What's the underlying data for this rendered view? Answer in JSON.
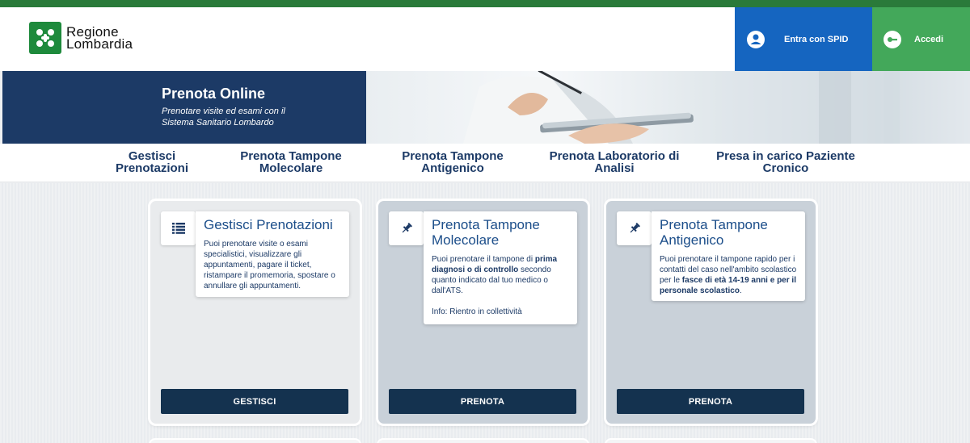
{
  "colors": {
    "brand_green": "#1e8a3c",
    "spid_blue": "#1565c0",
    "accedi_green": "#43a85a",
    "navy": "#1c3a66",
    "button_navy": "#14324f"
  },
  "header": {
    "logo_line1": "Regione",
    "logo_line2": "Lombardia",
    "spid_label": "Entra con SPID",
    "spid_icon": "user-icon",
    "accedi_label": "Accedi",
    "accedi_icon": "key-icon"
  },
  "hero": {
    "title": "Prenota Online",
    "subtitle_line1": "Prenotare visite ed esami con il",
    "subtitle_line2": "Sistema Sanitario Lombardo"
  },
  "nav": {
    "items": [
      {
        "line1": "Gestisci",
        "line2": "Prenotazioni"
      },
      {
        "line1": "Prenota Tampone",
        "line2": "Molecolare"
      },
      {
        "line1": "Prenota Tampone",
        "line2": "Antigenico"
      },
      {
        "line1": "Prenota Laboratorio di",
        "line2": "Analisi"
      },
      {
        "line1": "Presa in carico Paziente",
        "line2": "Cronico"
      }
    ]
  },
  "cards": [
    {
      "icon": "list-icon",
      "title_line1": "Gestisci Prenotazioni",
      "description": "Puoi prenotare visite o esami specialistici, visualizzare gli appuntamenti, pagare il ticket, ristampare il promemoria, spostare o annullare gli appuntamenti.",
      "button": "GESTISCI"
    },
    {
      "icon": "pin-icon",
      "title_line1": "Prenota Tampone",
      "title_line2": "Molecolare",
      "desc_part1": "Puoi prenotare il tampone di ",
      "desc_bold1": "prima diagnosi o di controllo",
      "desc_part2": " secondo quanto indicato dal tuo medico o dall'ATS.",
      "info": "Info: Rientro in collettività",
      "button": "PRENOTA"
    },
    {
      "icon": "pin-icon",
      "title_line1": "Prenota Tampone",
      "title_line2": "Antigenico",
      "desc_part1": "Puoi prenotare il tampone rapido per i contatti del caso nell'ambito scolastico per le ",
      "desc_bold1": "fasce di età 14-19 anni e per il personale scolastico",
      "desc_part2": ".",
      "button": "PRENOTA"
    }
  ]
}
